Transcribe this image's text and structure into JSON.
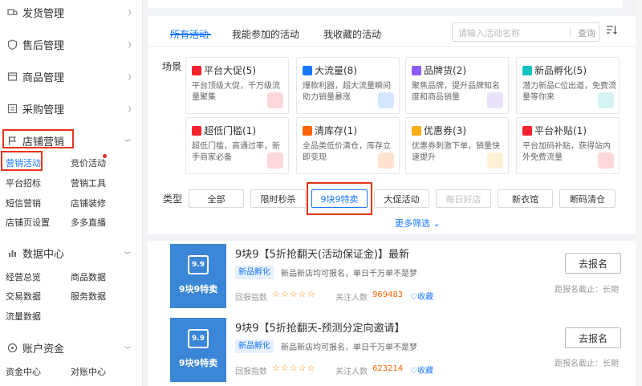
{
  "sidebar": {
    "sections": [
      {
        "label": "发货管理",
        "icon": "truck-icon"
      },
      {
        "label": "售后管理",
        "icon": "shield-icon"
      },
      {
        "label": "商品管理",
        "icon": "box-icon"
      },
      {
        "label": "采购管理",
        "icon": "list-icon"
      },
      {
        "label": "店铺营销",
        "icon": "flag-icon"
      },
      {
        "label": "数据中心",
        "icon": "bar-chart-icon"
      },
      {
        "label": "账户资金",
        "icon": "coin-icon"
      }
    ],
    "marketing_items": [
      "营销活动",
      "竞价活动",
      "平台招标",
      "营销工具",
      "短信营销",
      "店铺装修",
      "店铺页设置",
      "多多直播"
    ],
    "data_items": [
      "经营总览",
      "商品数据",
      "交易数据",
      "服务数据",
      "流量数据"
    ],
    "account_items": [
      "资金中心",
      "对账中心"
    ]
  },
  "tabs": [
    "所有活动",
    "我能参加的活动",
    "我收藏的活动"
  ],
  "search": {
    "placeholder": "请输入活动名称",
    "button": "查询"
  },
  "scene_label": "场景",
  "type_label": "类型",
  "scenes": [
    {
      "title": "平台大促(5)",
      "desc": "平台顶级大促，千万级流量聚集",
      "color": "#f5222d"
    },
    {
      "title": "大流量(8)",
      "desc": "爆款利器，超大流量瞬间助力销量暴涨",
      "color": "#1677ff"
    },
    {
      "title": "品牌货(2)",
      "desc": "聚焦品牌，提升品牌知名度和商品销量",
      "color": "#8b5cf6"
    },
    {
      "title": "新品孵化(5)",
      "desc": "潜力新品C位出道，免费流量等你来",
      "color": "#13c2c2"
    },
    {
      "title": "超低门槛(1)",
      "desc": "超低门槛，高通过率，新手商家必备",
      "color": "#f5222d"
    },
    {
      "title": "清库存(1)",
      "desc": "全品类低价清仓，库存立即变现",
      "color": "#fa6400"
    },
    {
      "title": "优惠券(3)",
      "desc": "优惠券刺激下单，销量快速提升",
      "color": "#faad14"
    },
    {
      "title": "平台补贴(1)",
      "desc": "平台加码补贴，获得站内外免费流量",
      "color": "#f5222d"
    }
  ],
  "types": [
    {
      "label": "全部",
      "state": "normal"
    },
    {
      "label": "限时秒杀",
      "state": "normal"
    },
    {
      "label": "9块9特卖",
      "state": "active"
    },
    {
      "label": "大促活动",
      "state": "normal"
    },
    {
      "label": "每日好店",
      "state": "disabled"
    },
    {
      "label": "新衣馆",
      "state": "normal"
    },
    {
      "label": "断码清仓",
      "state": "normal"
    }
  ],
  "more_filter": "更多筛选",
  "activities": [
    {
      "thumb_badge": "9.9",
      "thumb_label": "9块9特卖",
      "title": "9块9【5折抢翻天(活动保证金)】最新",
      "tag": "新品孵化",
      "desc": "新品新店均可报名，单日千万单不是梦",
      "return_label": "回报指数",
      "stars": "☆☆☆☆☆",
      "followers_label": "关注人数",
      "followers": "969483",
      "fav_label": "收藏",
      "button": "去报名",
      "deadline": "距报名截止：长期"
    },
    {
      "thumb_badge": "9.9",
      "thumb_label": "9块9特卖",
      "title": "9块9【5折抢翻天-预测分定向邀请】",
      "tag": "新品孵化",
      "desc": "新品新店均可报名，单日千万单不是梦",
      "return_label": "回报指数",
      "stars": "☆☆☆☆☆",
      "followers_label": "关注人数",
      "followers": "623214",
      "fav_label": "收藏",
      "button": "去报名",
      "deadline": "距报名截止：长期"
    }
  ]
}
